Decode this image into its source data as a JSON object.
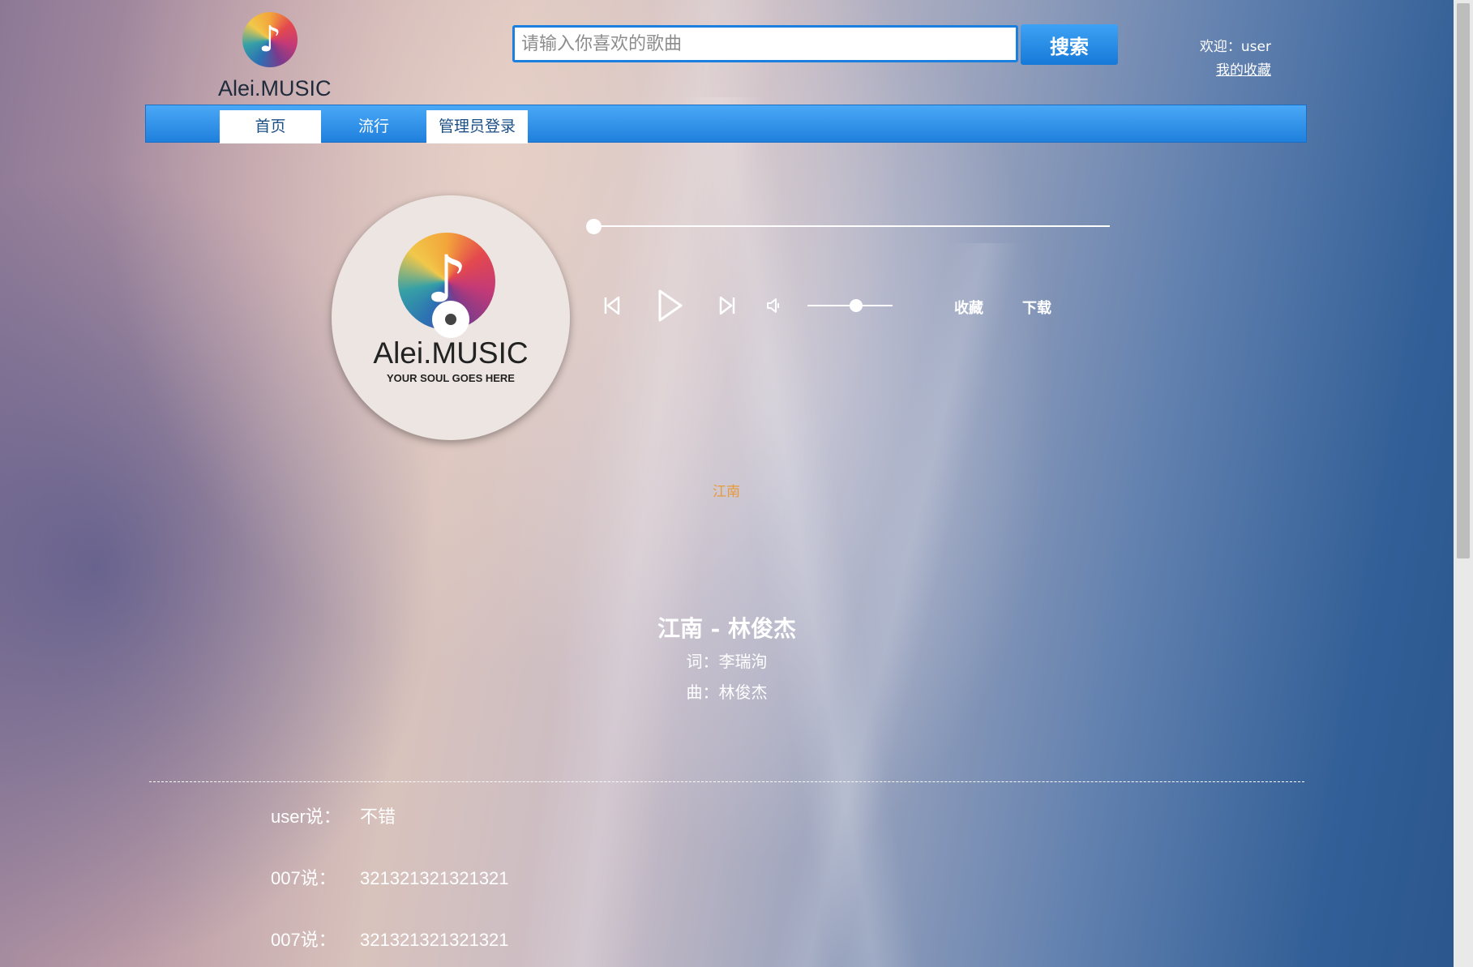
{
  "header": {
    "brand": "Alei.MUSIC",
    "search_placeholder": "请输入你喜欢的歌曲",
    "search_button": "搜索",
    "welcome": "欢迎：user",
    "my_favorites": "我的收藏"
  },
  "nav": {
    "tabs": [
      {
        "label": "首页",
        "active": true
      },
      {
        "label": "流行",
        "active": false
      },
      {
        "label": "管理员登录",
        "active": true
      }
    ]
  },
  "disc": {
    "brand": "Alei.MUSIC",
    "tagline": "YOUR SOUL GOES HERE"
  },
  "player": {
    "progress": 0.0,
    "volume": 0.5,
    "favorite_label": "收藏",
    "download_label": "下载",
    "current_lyric": "江南"
  },
  "song": {
    "title": "江南 - 林俊杰",
    "lyricist": "词：李瑞洵",
    "composer": "曲：林俊杰"
  },
  "comments": [
    {
      "user": "user说：",
      "text": "不错"
    },
    {
      "user": "007说：",
      "text": "321321321321321"
    },
    {
      "user": "007说：",
      "text": "321321321321321"
    }
  ],
  "colors": {
    "accent_blue": "#1b7fe0",
    "lyric_highlight": "#e89a3b"
  },
  "icons": [
    "music-note-logo-icon",
    "previous-icon",
    "play-icon",
    "next-icon",
    "volume-icon"
  ]
}
